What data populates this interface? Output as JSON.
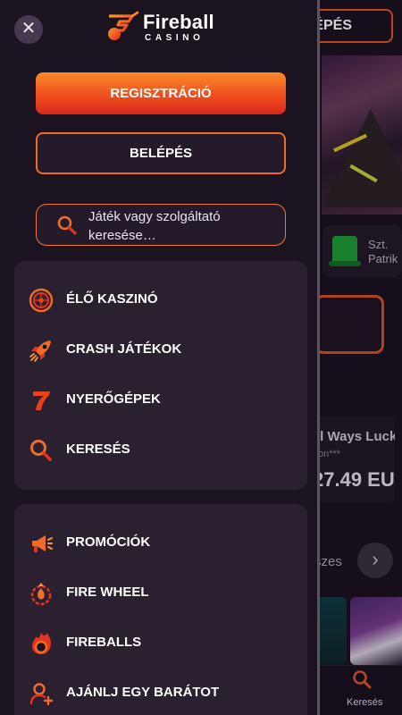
{
  "background": {
    "login_label": "LÉPÉS",
    "tile_text": "Szt.\nPatrik",
    "game_title": "ll Ways Luck",
    "game_sub": "on***",
    "game_amount": "27.49 EU",
    "all_label": "szes",
    "tab_label": "Keresés"
  },
  "drawer": {
    "logo_name": "Fireball",
    "logo_sub": "CASINO",
    "register_label": "REGISZTRÁCIÓ",
    "login_label": "BELÉPÉS",
    "search_placeholder": "Játék vagy szolgáltató keresése…",
    "menu_group_1": [
      {
        "label": "ÉLŐ KASZINÓ",
        "icon": "roulette-icon"
      },
      {
        "label": "CRASH JÁTÉKOK",
        "icon": "rocket-icon"
      },
      {
        "label": "NYERŐGÉPEK",
        "icon": "seven-icon"
      },
      {
        "label": "KERESÉS",
        "icon": "search-icon"
      }
    ],
    "menu_group_2": [
      {
        "label": "PROMÓCIÓK",
        "icon": "megaphone-icon"
      },
      {
        "label": "FIRE WHEEL",
        "icon": "fire-wheel-icon"
      },
      {
        "label": "FIREBALLS",
        "icon": "fireball-icon"
      },
      {
        "label": "AJÁNLJ EGY BARÁTOT",
        "icon": "add-user-icon"
      }
    ]
  },
  "colors": {
    "accent": "#f06b28",
    "accent_red": "#d8281a",
    "drawer_bg": "#1c1321",
    "card_bg": "#2a2030"
  }
}
